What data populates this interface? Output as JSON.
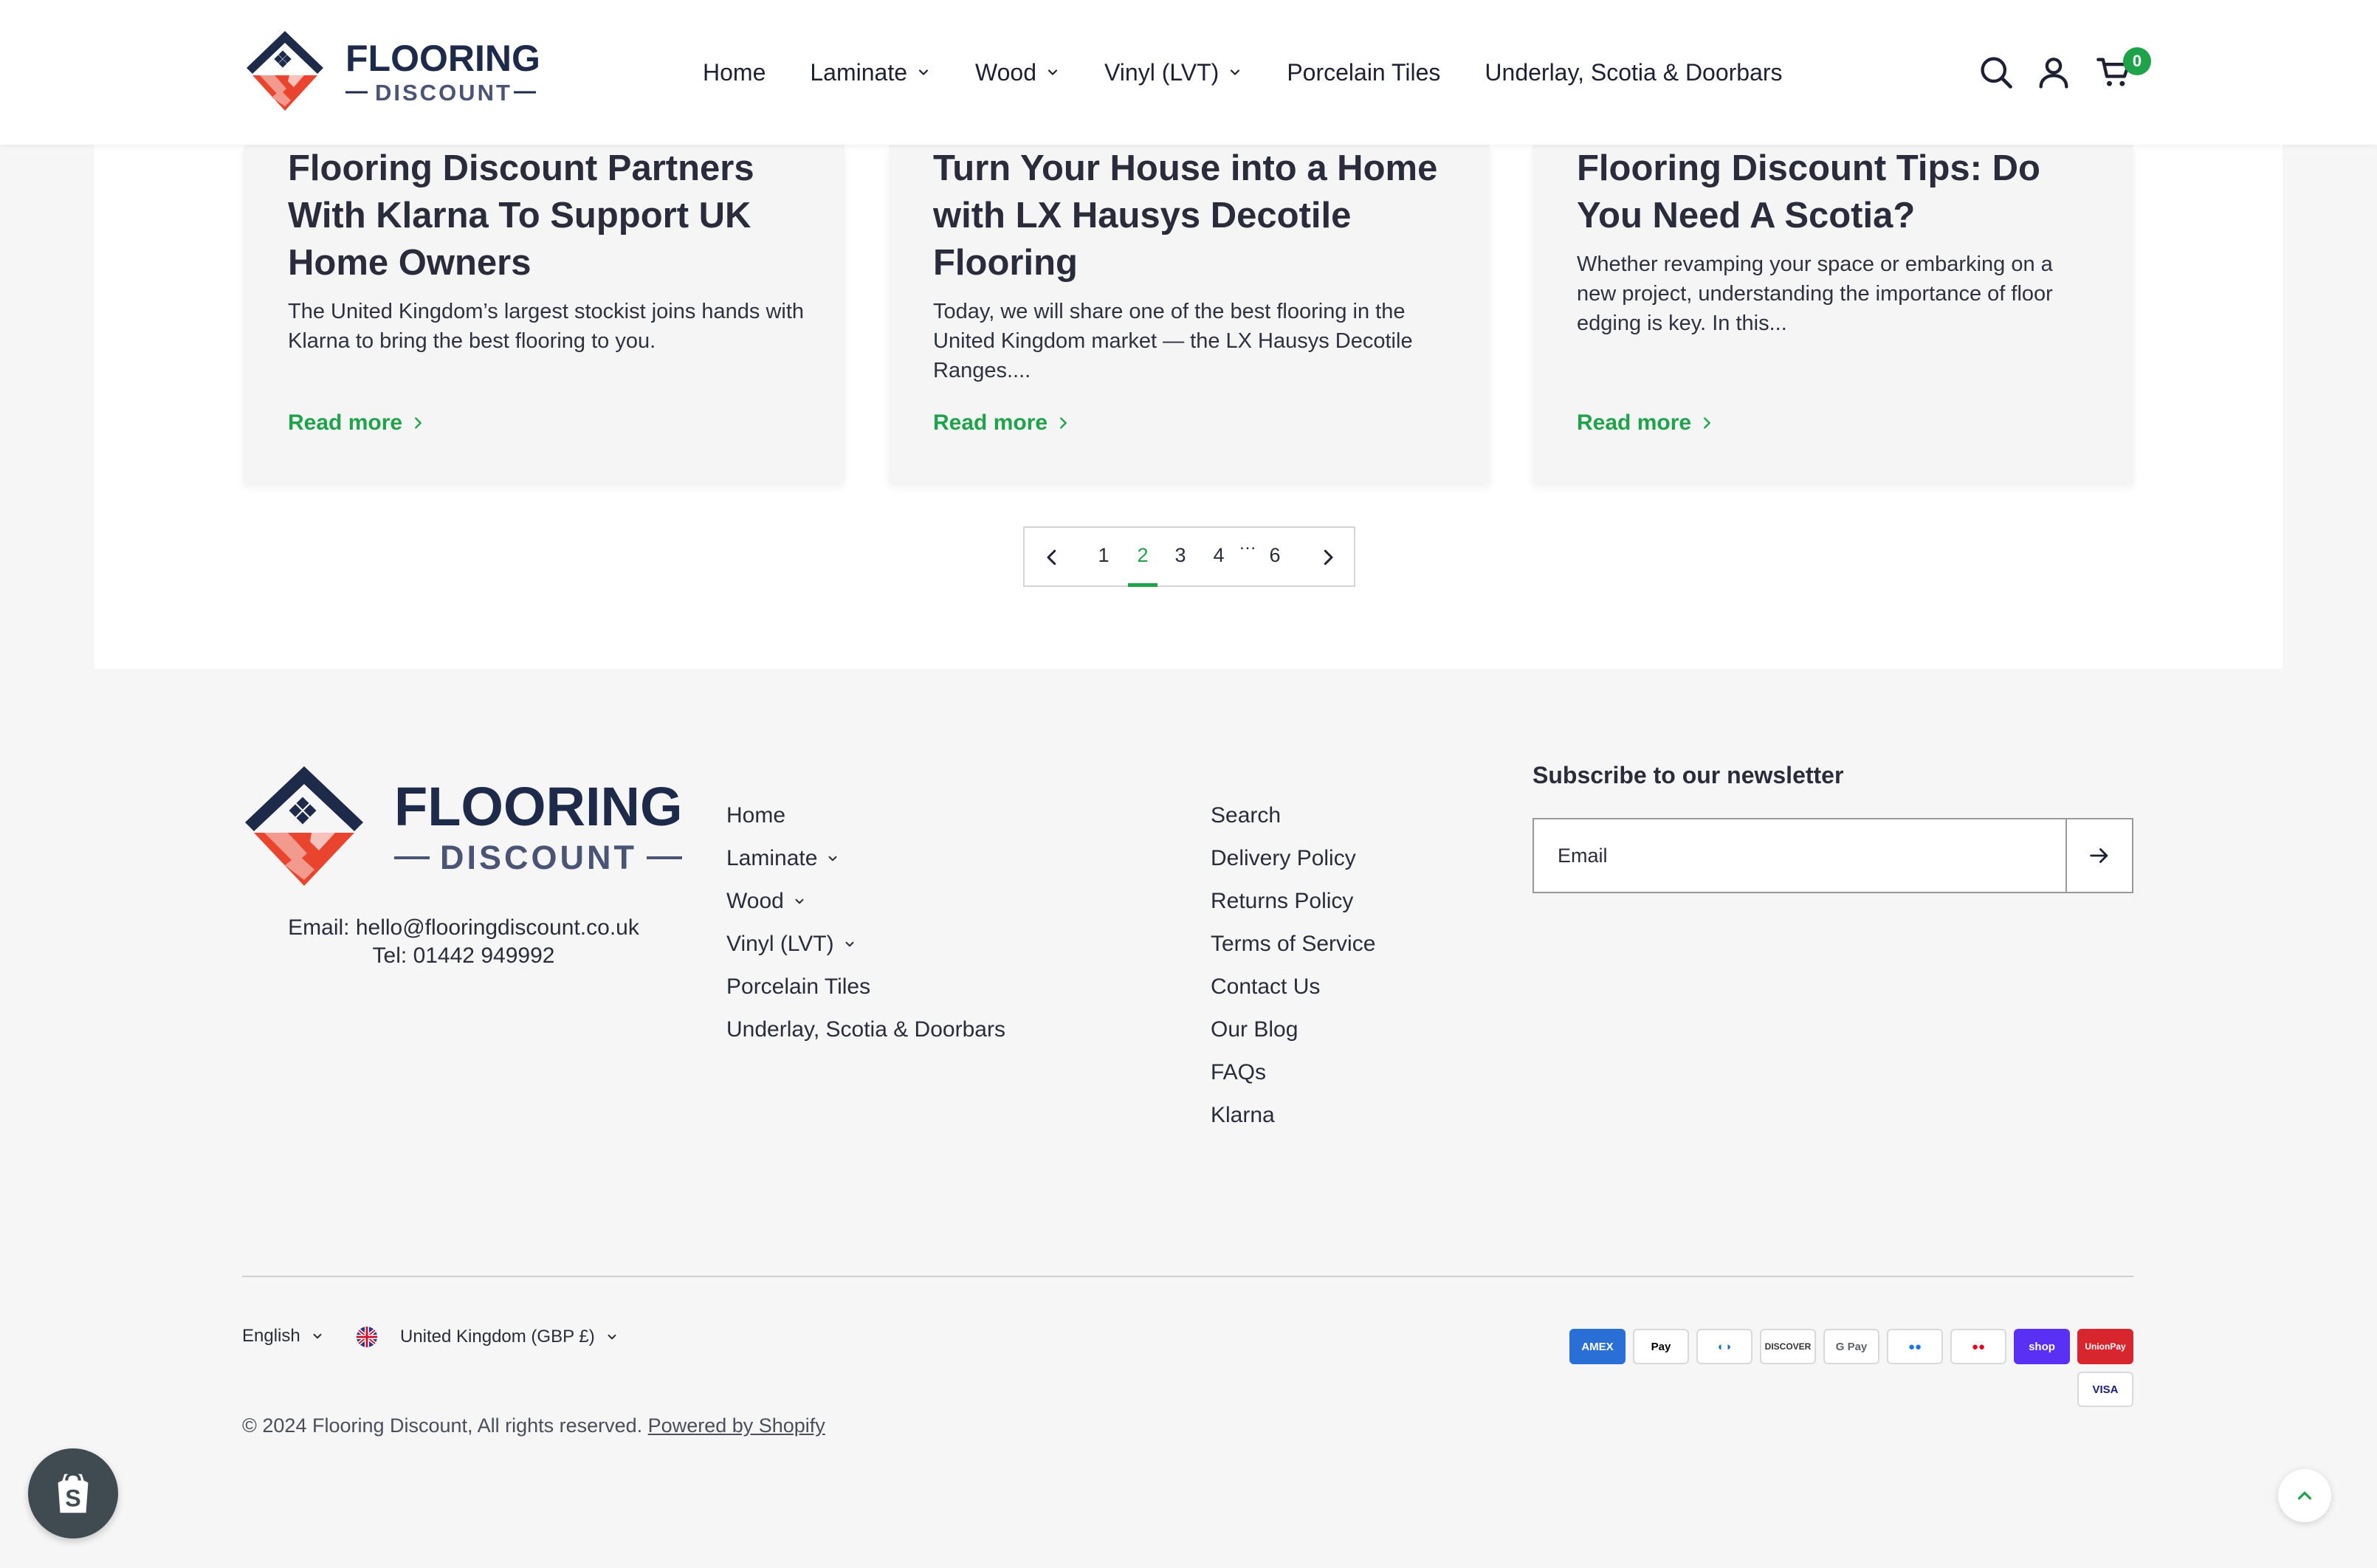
{
  "brand": {
    "name_top": "FLOORING",
    "name_bottom": "DISCOUNT",
    "navy": "#1e2a4a",
    "accent": "#1fa34a",
    "logo_red": "#e8442e"
  },
  "header": {
    "nav": [
      {
        "label": "Home",
        "dropdown": false
      },
      {
        "label": "Laminate",
        "dropdown": true
      },
      {
        "label": "Wood",
        "dropdown": true
      },
      {
        "label": "Vinyl (LVT)",
        "dropdown": true
      },
      {
        "label": "Porcelain Tiles",
        "dropdown": false
      },
      {
        "label": "Underlay, Scotia & Doorbars",
        "dropdown": false
      }
    ],
    "icons": [
      "search-icon",
      "account-icon",
      "cart-icon"
    ],
    "cart_count": "0"
  },
  "blog": {
    "cards": [
      {
        "title": "Flooring Discount Partners With Klarna To Support UK Home Owners",
        "excerpt": "The United Kingdom’s largest stockist joins hands with Klarna to bring the best flooring to you.",
        "read_more": "Read more"
      },
      {
        "title": "Turn Your House into a Home with LX Hausys Decotile Flooring",
        "excerpt": "Today, we will share one of the best flooring in the United Kingdom market — the LX Hausys Decotile Ranges....",
        "read_more": "Read more"
      },
      {
        "title": "Flooring Discount Tips: Do You Need A Scotia?",
        "excerpt": "Whether revamping your space or embarking on a new project, understanding the importance of floor edging is key. In this...",
        "read_more": "Read more"
      }
    ],
    "pagination": {
      "pages": [
        "1",
        "2",
        "3",
        "4",
        "6"
      ],
      "ellipsis": "…",
      "current": "2"
    }
  },
  "footer": {
    "contact": {
      "email": "Email: hello@flooringdiscount.co.uk",
      "tel": "Tel: 01442 949992"
    },
    "menu_main": [
      {
        "label": "Home",
        "dropdown": false
      },
      {
        "label": "Laminate",
        "dropdown": true
      },
      {
        "label": "Wood",
        "dropdown": true
      },
      {
        "label": "Vinyl (LVT)",
        "dropdown": true
      },
      {
        "label": "Porcelain Tiles",
        "dropdown": false
      },
      {
        "label": "Underlay, Scotia & Doorbars",
        "dropdown": false
      }
    ],
    "menu_info": [
      "Search",
      "Delivery Policy",
      "Returns Policy",
      "Terms of Service",
      "Contact Us",
      "Our Blog",
      "FAQs",
      "Klarna"
    ],
    "newsletter": {
      "title": "Subscribe to our newsletter",
      "placeholder": "Email"
    },
    "language": "English",
    "country": "United Kingdom (GBP £)",
    "copyright": "© 2024 Flooring Discount, All rights reserved.",
    "powered_by": "Powered by Shopify",
    "payments": [
      {
        "label": "AMEX",
        "icon": "amex-icon",
        "bg": "#2a6fd6",
        "fg": "#ffffff"
      },
      {
        "label": "Pay",
        "icon": "apple-pay-icon",
        "bg": "#ffffff",
        "fg": "#000000"
      },
      {
        "label": "◐◑",
        "icon": "diners-club-icon",
        "bg": "#ffffff",
        "fg": "#1a6fb8"
      },
      {
        "label": "DISCOVER",
        "icon": "discover-icon",
        "bg": "#ffffff",
        "fg": "#333333"
      },
      {
        "label": "G Pay",
        "icon": "google-pay-icon",
        "bg": "#ffffff",
        "fg": "#5f6368"
      },
      {
        "label": "●●",
        "icon": "maestro-icon",
        "bg": "#ffffff",
        "fg": "#1a73e8"
      },
      {
        "label": "●●",
        "icon": "mastercard-icon",
        "bg": "#ffffff",
        "fg": "#eb001b"
      },
      {
        "label": "shop",
        "icon": "shop-pay-icon",
        "bg": "#5a31f4",
        "fg": "#ffffff"
      },
      {
        "label": "UnionPay",
        "icon": "unionpay-icon",
        "bg": "#d7262e",
        "fg": "#ffffff"
      },
      {
        "label": "VISA",
        "icon": "visa-icon",
        "bg": "#ffffff",
        "fg": "#1a1f71"
      }
    ]
  }
}
